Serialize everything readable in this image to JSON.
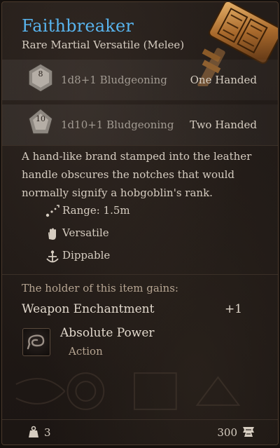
{
  "item": {
    "name": "Faithbreaker",
    "subtitle": "Rare Martial Versatile (Melee)",
    "rarity_color": "#58b4ee",
    "art_icon": "warhammer-icon"
  },
  "damage": [
    {
      "die": "8",
      "die_icon": "d8-die-icon",
      "text": "1d8+1 Bludgeoning",
      "hand": "One Handed"
    },
    {
      "die": "10",
      "die_icon": "d10-die-icon",
      "text": "1d10+1 Bludgeoning",
      "hand": "Two Handed"
    }
  ],
  "description": "A hand-like brand stamped into the leather handle obscures the notches that would normally signify a hobgoblin's rank.",
  "properties": [
    {
      "icon": "range-icon",
      "label": "Range: 1.5m"
    },
    {
      "icon": "versatile-hand-icon",
      "label": "Versatile"
    },
    {
      "icon": "dippable-icon",
      "label": "Dippable"
    }
  ],
  "gains": {
    "heading": "The holder of this item gains:",
    "enchantment": {
      "name": "Weapon Enchantment",
      "value": "+1"
    },
    "action": {
      "name": "Absolute Power",
      "type": "Action",
      "icon": "absolute-power-icon"
    }
  },
  "footer": {
    "weight": "3",
    "weight_icon": "weight-icon",
    "price": "300",
    "price_icon": "gold-icon"
  }
}
